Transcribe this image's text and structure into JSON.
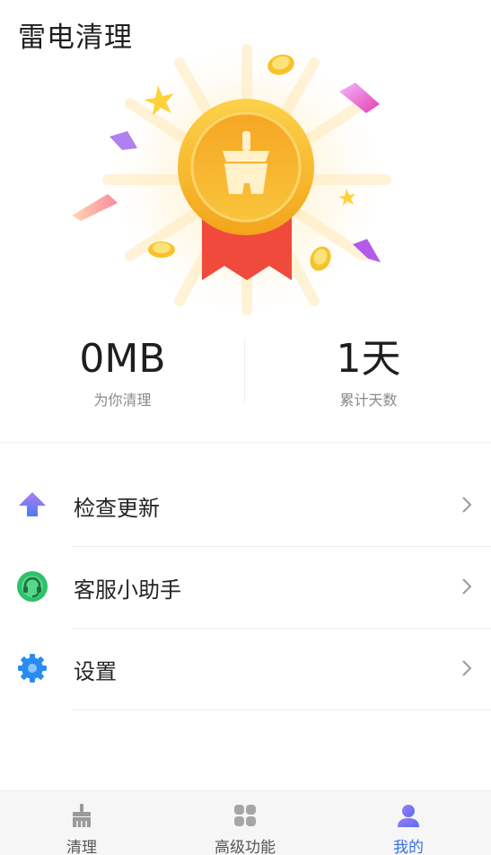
{
  "app": {
    "title": "雷电清理"
  },
  "stats": {
    "cleaned": {
      "value": "0MB",
      "label": "为你清理"
    },
    "days": {
      "value": "1天",
      "label": "累计天数"
    }
  },
  "menu": [
    {
      "label": "检查更新",
      "icon": "update-arrow-icon"
    },
    {
      "label": "客服小助手",
      "icon": "headset-icon"
    },
    {
      "label": "设置",
      "icon": "gear-icon"
    }
  ],
  "tabs": [
    {
      "label": "清理",
      "icon": "broom-icon",
      "active": false
    },
    {
      "label": "高级功能",
      "icon": "grid-icon",
      "active": false
    },
    {
      "label": "我的",
      "icon": "user-icon",
      "active": true
    }
  ],
  "colors": {
    "accent": "#3b6fe0",
    "medal": "#f8b62a",
    "ribbon": "#ef4a3c"
  }
}
